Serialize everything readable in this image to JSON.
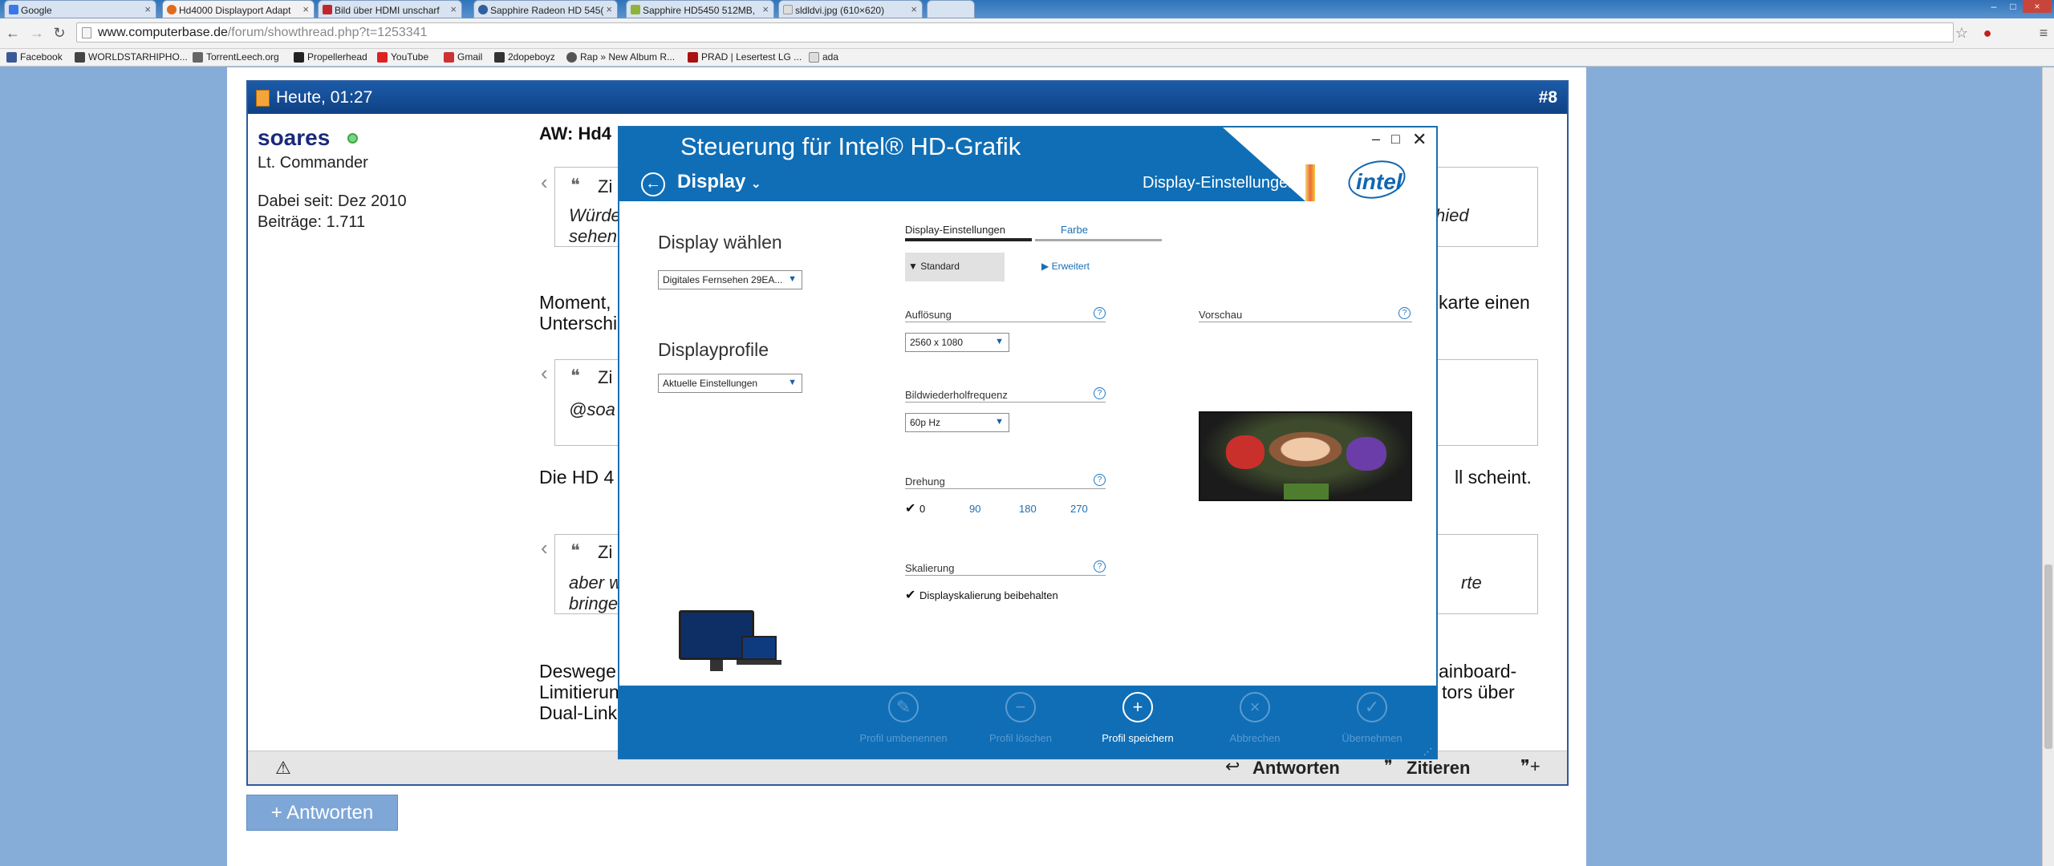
{
  "browser": {
    "tabs": [
      {
        "title": "Google"
      },
      {
        "title": "Hd4000 Displayport Adapt"
      },
      {
        "title": "Bild über HDMI unscharf"
      },
      {
        "title": "Sapphire Radeon HD 545("
      },
      {
        "title": "Sapphire HD5450 512MB,"
      },
      {
        "title": "sldldvi.jpg (610×620)"
      }
    ],
    "url_host": "www.computerbase.de",
    "url_path": "/forum/showthread.php?t=1253341",
    "bookmarks": [
      "Facebook",
      "WORLDSTARHIPHO...",
      "TorrentLeech.org",
      "Propellerhead",
      "YouTube",
      "Gmail",
      "2dopeboyz",
      "Rap » New Album R...",
      "PRAD | Lesertest LG ...",
      "ada"
    ]
  },
  "post": {
    "date": "Heute, 01:27",
    "number": "#8",
    "username": "soares",
    "rank": "Lt. Commander",
    "joined": "Dabei seit: Dez 2010",
    "posts": "Beiträge: 1.711",
    "title_visible": "AW: Hd4",
    "quote1_label": "Zi",
    "quote1_line1_left": "Würde",
    "quote1_line1_right": "hied",
    "quote1_line2_left": "sehen",
    "p1_left": "Moment,",
    "p1_right": "karte einen",
    "p1_line2_left": "Unterschi",
    "quote2_label": "Zi",
    "quote2_text": "@soa",
    "p2_left": "Die HD 4",
    "p2_right": "ll scheint.",
    "quote3_label": "Zi",
    "quote3_line1_left": "aber w",
    "quote3_line1_right": "rte",
    "quote3_line2_left": "bringe",
    "p3_line1_left": "Deswege",
    "p3_line1_right": "ainboard-",
    "p3_line2_left": "Limitierun",
    "p3_line2_right": "tors über",
    "p3_line3_left": "Dual-Link",
    "reply_label": "Antworten",
    "quote_label": "Zitieren",
    "reply_big": "+ Antworten"
  },
  "dialog": {
    "title": "Steuerung für Intel® HD-Grafik",
    "section": "Display",
    "breadcrumb": "Display-Einstellungen",
    "brand": "intel",
    "left": {
      "display_heading": "Display wählen",
      "display_value": "Digitales Fernsehen 29EA...",
      "profile_heading": "Displayprofile",
      "profile_value": "Aktuelle Einstellungen"
    },
    "tabs": [
      "Display-Einstellungen",
      "Farbe"
    ],
    "mode_standard": "Standard",
    "mode_advanced": "Erweitert",
    "resolution_label": "Auflösung",
    "resolution_value": "2560 x 1080",
    "refresh_label": "Bildwiederholfrequenz",
    "refresh_value": "60p Hz",
    "rotation_label": "Drehung",
    "rotation_options": [
      "0",
      "90",
      "180",
      "270"
    ],
    "scaling_label": "Skalierung",
    "scaling_option": "Displayskalierung beibehalten",
    "preview_label": "Vorschau",
    "footer_buttons": [
      {
        "label": "Profil umbenennen",
        "icon": "pencil-icon",
        "enabled": false
      },
      {
        "label": "Profil löschen",
        "icon": "minus-icon",
        "enabled": false
      },
      {
        "label": "Profil speichern",
        "icon": "plus-icon",
        "enabled": true
      },
      {
        "label": "Abbrechen",
        "icon": "x-icon",
        "enabled": false
      },
      {
        "label": "Übernehmen",
        "icon": "check-icon",
        "enabled": false
      }
    ]
  }
}
